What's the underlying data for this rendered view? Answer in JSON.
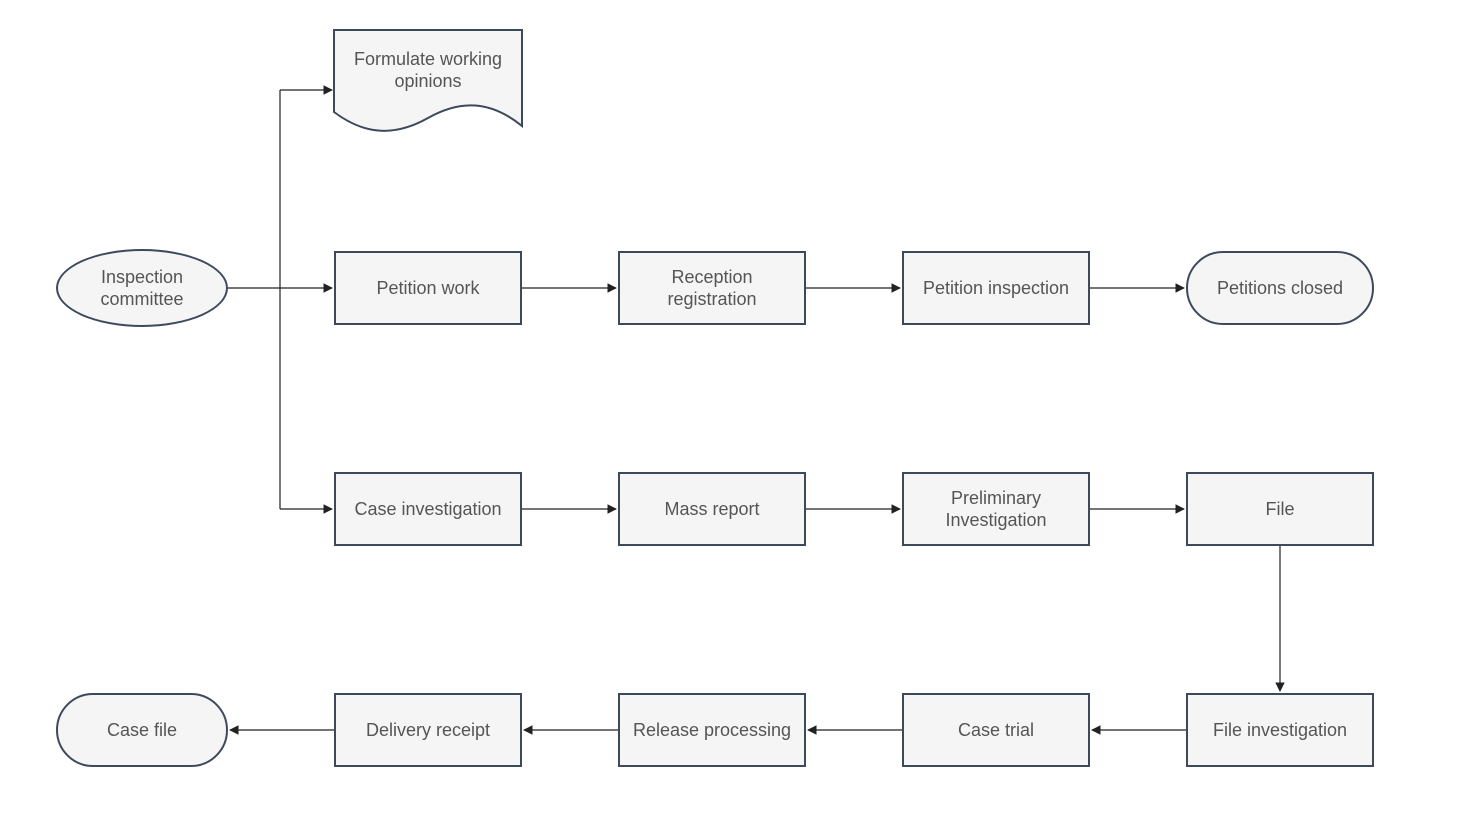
{
  "nodes": {
    "inspection_committee": "Inspection committee",
    "formulate_opinions": "Formulate working opinions",
    "petition_work": "Petition work",
    "reception_registration": "Reception registration",
    "petition_inspection": "Petition inspection",
    "petitions_closed": "Petitions closed",
    "case_investigation": "Case investigation",
    "mass_report": "Mass report",
    "preliminary_investigation": "Preliminary Investigation",
    "file": "File",
    "file_investigation": "File investigation",
    "case_trial": "Case trial",
    "release_processing": "Release processing",
    "delivery_receipt": "Delivery receipt",
    "case_file": "Case file"
  },
  "edges": [
    {
      "from": "inspection_committee",
      "to": "formulate_opinions"
    },
    {
      "from": "inspection_committee",
      "to": "petition_work"
    },
    {
      "from": "inspection_committee",
      "to": "case_investigation"
    },
    {
      "from": "petition_work",
      "to": "reception_registration"
    },
    {
      "from": "reception_registration",
      "to": "petition_inspection"
    },
    {
      "from": "petition_inspection",
      "to": "petitions_closed"
    },
    {
      "from": "case_investigation",
      "to": "mass_report"
    },
    {
      "from": "mass_report",
      "to": "preliminary_investigation"
    },
    {
      "from": "preliminary_investigation",
      "to": "file"
    },
    {
      "from": "file",
      "to": "file_investigation"
    },
    {
      "from": "file_investigation",
      "to": "case_trial"
    },
    {
      "from": "case_trial",
      "to": "release_processing"
    },
    {
      "from": "release_processing",
      "to": "delivery_receipt"
    },
    {
      "from": "delivery_receipt",
      "to": "case_file"
    }
  ]
}
